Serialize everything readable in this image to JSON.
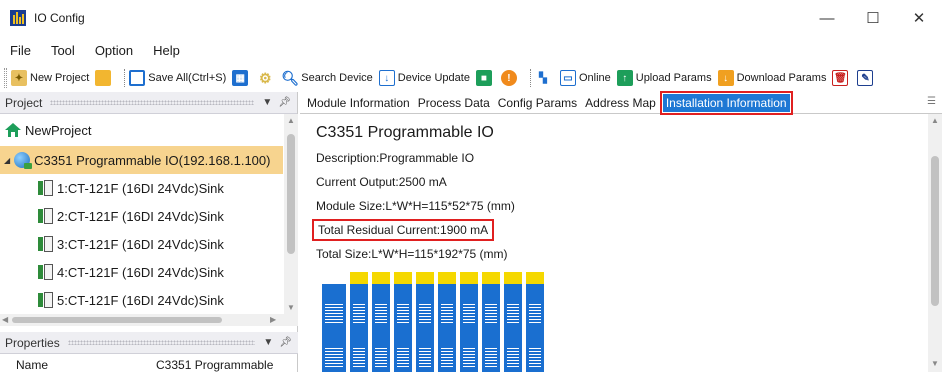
{
  "window": {
    "title": "IO Config",
    "minimize": "—",
    "maximize": "☐",
    "close": "✕"
  },
  "menu": [
    "File",
    "Tool",
    "Option",
    "Help"
  ],
  "toolbar": {
    "new_project": "New Project",
    "save_all": "Save All(Ctrl+S)",
    "search_device": "Search Device",
    "device_update": "Device Update",
    "online": "Online",
    "upload_params": "Upload Params",
    "download_params": "Download Params"
  },
  "project_panel": {
    "title": "Project",
    "root": "NewProject",
    "device": "C3351 Programmable IO(192.168.1.100)",
    "modules": [
      "1:CT-121F (16DI 24Vdc)Sink",
      "2:CT-121F (16DI 24Vdc)Sink",
      "3:CT-121F (16DI 24Vdc)Sink",
      "4:CT-121F (16DI 24Vdc)Sink",
      "5:CT-121F (16DI 24Vdc)Sink"
    ]
  },
  "properties_panel": {
    "title": "Properties",
    "rows": [
      {
        "key": "Name",
        "value": "C3351 Programmable"
      }
    ]
  },
  "tabs": [
    "Module Information",
    "Process Data",
    "Config Params",
    "Address Map",
    "Installation Information"
  ],
  "active_tab": "Installation Information",
  "installation_info": {
    "title": "C3351 Programmable IO",
    "description": "Description:Programmable IO",
    "current_output": "Current Output:2500 mA",
    "module_size": "Module Size:L*W*H=115*52*75 (mm)",
    "total_residual_current": "Total Residual Current:1900 mA",
    "total_size": "Total Size:L*W*H=115*192*75 (mm)"
  },
  "colors": {
    "selection": "#f7d48f",
    "active_tab": "#1e78d4",
    "highlight_box": "#e02020",
    "module_blue": "#1a6fd0",
    "module_cap": "#f5d800"
  }
}
